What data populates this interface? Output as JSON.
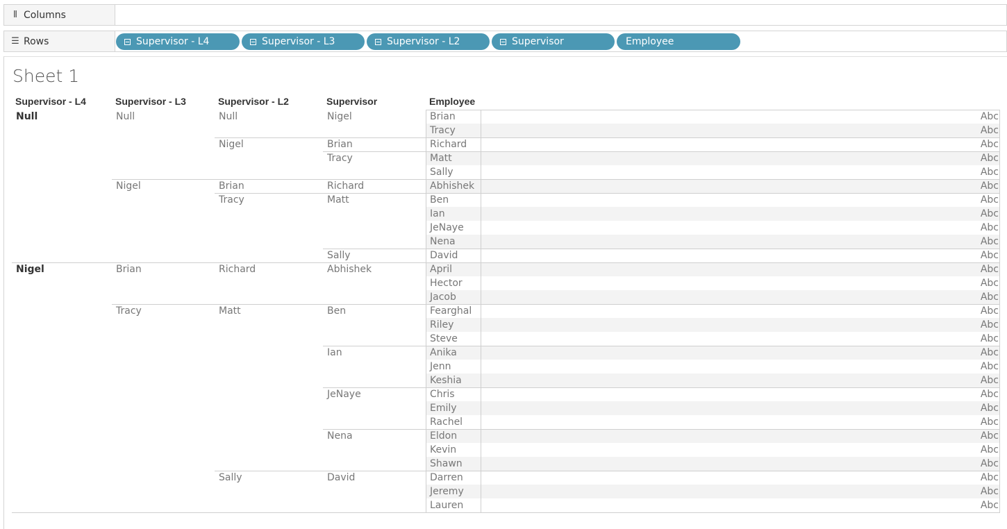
{
  "shelves": {
    "columns_label": "Columns",
    "rows_label": "Rows",
    "row_pills": [
      {
        "label": "Supervisor - L4",
        "collapsible": true
      },
      {
        "label": "Supervisor - L3",
        "collapsible": true
      },
      {
        "label": "Supervisor - L2",
        "collapsible": true
      },
      {
        "label": "Supervisor",
        "collapsible": true
      },
      {
        "label": "Employee",
        "collapsible": false
      }
    ]
  },
  "sheet": {
    "title": "Sheet 1",
    "headers": [
      "Supervisor - L4",
      "Supervisor - L3",
      "Supervisor - L2",
      "Supervisor",
      "Employee"
    ],
    "mark_label": "Abc",
    "rows": [
      [
        "Null",
        "Null",
        "Null",
        "Nigel",
        "Brian"
      ],
      [
        "Null",
        "Null",
        "Null",
        "Nigel",
        "Tracy"
      ],
      [
        "Null",
        "Null",
        "Nigel",
        "Brian",
        "Richard"
      ],
      [
        "Null",
        "Null",
        "Nigel",
        "Tracy",
        "Matt"
      ],
      [
        "Null",
        "Null",
        "Nigel",
        "Tracy",
        "Sally"
      ],
      [
        "Null",
        "Nigel",
        "Brian",
        "Richard",
        "Abhishek"
      ],
      [
        "Null",
        "Nigel",
        "Tracy",
        "Matt",
        "Ben"
      ],
      [
        "Null",
        "Nigel",
        "Tracy",
        "Matt",
        "Ian"
      ],
      [
        "Null",
        "Nigel",
        "Tracy",
        "Matt",
        "JeNaye"
      ],
      [
        "Null",
        "Nigel",
        "Tracy",
        "Matt",
        "Nena"
      ],
      [
        "Null",
        "Nigel",
        "Tracy",
        "Sally",
        "David"
      ],
      [
        "Nigel",
        "Brian",
        "Richard",
        "Abhishek",
        "April"
      ],
      [
        "Nigel",
        "Brian",
        "Richard",
        "Abhishek",
        "Hector"
      ],
      [
        "Nigel",
        "Brian",
        "Richard",
        "Abhishek",
        "Jacob"
      ],
      [
        "Nigel",
        "Tracy",
        "Matt",
        "Ben",
        "Fearghal"
      ],
      [
        "Nigel",
        "Tracy",
        "Matt",
        "Ben",
        "Riley"
      ],
      [
        "Nigel",
        "Tracy",
        "Matt",
        "Ben",
        "Steve"
      ],
      [
        "Nigel",
        "Tracy",
        "Matt",
        "Ian",
        "Anika"
      ],
      [
        "Nigel",
        "Tracy",
        "Matt",
        "Ian",
        "Jenn"
      ],
      [
        "Nigel",
        "Tracy",
        "Matt",
        "Ian",
        "Keshia"
      ],
      [
        "Nigel",
        "Tracy",
        "Matt",
        "JeNaye",
        "Chris"
      ],
      [
        "Nigel",
        "Tracy",
        "Matt",
        "JeNaye",
        "Emily"
      ],
      [
        "Nigel",
        "Tracy",
        "Matt",
        "JeNaye",
        "Rachel"
      ],
      [
        "Nigel",
        "Tracy",
        "Matt",
        "Nena",
        "Eldon"
      ],
      [
        "Nigel",
        "Tracy",
        "Matt",
        "Nena",
        "Kevin"
      ],
      [
        "Nigel",
        "Tracy",
        "Matt",
        "Nena",
        "Shawn"
      ],
      [
        "Nigel",
        "Tracy",
        "Sally",
        "David",
        "Darren"
      ],
      [
        "Nigel",
        "Tracy",
        "Sally",
        "David",
        "Jeremy"
      ],
      [
        "Nigel",
        "Tracy",
        "Sally",
        "David",
        "Lauren"
      ]
    ]
  },
  "colors": {
    "pill": "#4b98b4",
    "band": "#f3f3f3",
    "grid": "#cfcfcf"
  },
  "icons": {
    "columns": "columns-icon",
    "rows": "rows-icon",
    "collapse": "collapse-icon"
  }
}
